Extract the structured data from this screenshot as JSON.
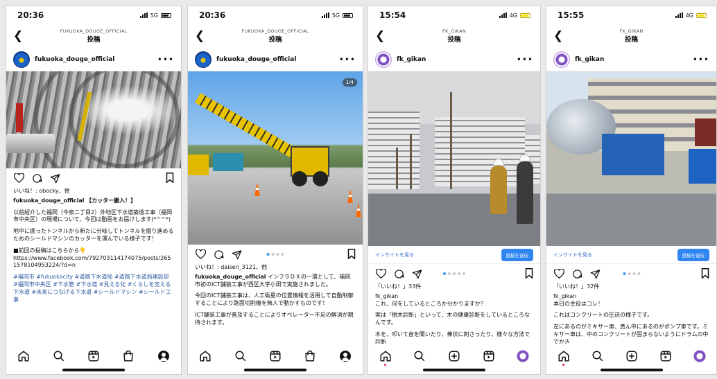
{
  "colors": {
    "link_blue": "#2f6dd0",
    "promote_blue": "#2f86f1",
    "hashtag_blue": "#2c58a0",
    "carousel_dot_active": "#3897f0"
  },
  "icons": [
    "back-chevron-icon",
    "more-dots-icon",
    "heart-icon",
    "comment-icon",
    "share-icon",
    "bookmark-icon",
    "home-icon",
    "search-icon",
    "reels-icon",
    "shop-icon",
    "create-icon",
    "profile-icon"
  ],
  "phones": [
    {
      "time": "20:36",
      "network": "5G",
      "nav_account": "FUKUOKA_DOUGE_OFFICIAL",
      "nav_title": "投稿",
      "username": "fukuoka_douge_official",
      "likes": "いいね！: obocky、他",
      "caption_user": "fukuoka_douge_official",
      "caption_title": "【カッター搬入！】",
      "paragraphs": [
        "以前紹介した福岡（今泉二丁目2）外地区下水道築造工事（福岡市中央区）の現場について、今回は動画をお届けします(*^^*)",
        "地中に掘ったトンネルから新たに分岐してトンネルを掘り進めるためのシールドマシンのカッターを運んでいる様子です！",
        "■前回の投稿はこちらから👇"
      ],
      "link": "https://www.facebook.com/792703114174075/posts/2651578104953224/?d=n",
      "hashtags": "#福岡市 #fukuokacity #道路下水道局 #道路下水道局建設部 #福岡市中央区 #下水管 #下水道 #見える化 #くらしを支える下水道 #未来につなげる下水道 #シールドマシン #シールド工事"
    },
    {
      "time": "20:36",
      "network": "5G",
      "nav_account": "FUKUOKA_DOUGE_OFFICIAL",
      "nav_title": "投稿",
      "username": "fukuoka_douge_official",
      "counter": "1/4",
      "likes": "いいね！: daisen_3121、他",
      "caption_user": "fukuoka_douge_official",
      "caption_text": "インフラＤＸの一環として、福岡市初のICT舗装工事が西区大字小田で実施されました。",
      "paragraphs": [
        "今回のICT舗装工事は、人工衛星の位置情報を活用して自動制御することにより路面切削機を無人で動かすものです！",
        "ICT舗装工事が普及することによりオペレーター不足の解消が期待されます。"
      ]
    },
    {
      "time": "15:54",
      "network": "4G",
      "nav_account": "FK_GIKAN",
      "nav_title": "投稿",
      "username": "fk_gikan",
      "insight_link": "インサイトを見る",
      "promote_label": "投稿を宣伝",
      "likes": "「いいね！」33件",
      "caption_user": "fk_gikan",
      "caption_text": "これ、何をしているところか分かりますか？",
      "paragraphs": [
        "実は「樹木診断」といって、木の健康診断をしているところなんです。",
        "木を、叩いて音を聞いたり、棒状に刺さったり、様々な方法で診断"
      ]
    },
    {
      "time": "15:55",
      "network": "4G",
      "nav_account": "FK_GIKAN",
      "nav_title": "投稿",
      "username": "fk_gikan",
      "insight_link": "インサイトを見る",
      "promote_label": "投稿を宣伝",
      "likes": "「いいね！」32件",
      "caption_user": "fk_gikan",
      "caption_text": "本日の主役はコレ！",
      "paragraphs": [
        "これはコンクリートの圧送の様子です。",
        "左にあるのがミキサー車、真ん中にあるのがポンプ車です。ミキサー車は、中のコンクリートが固まらないようにドラムの中でかき"
      ]
    }
  ]
}
